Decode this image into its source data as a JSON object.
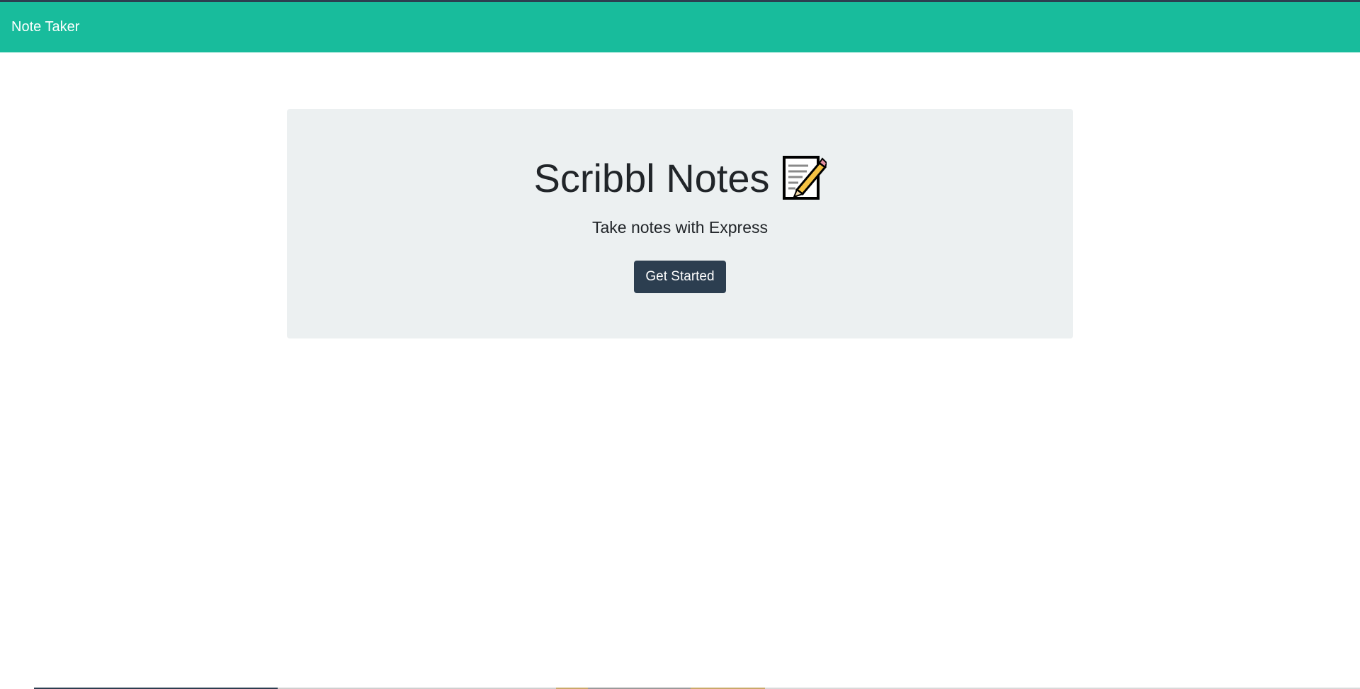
{
  "navbar": {
    "brand": "Note Taker"
  },
  "hero": {
    "title": "Scribbl Notes",
    "icon": "memo-icon",
    "subtitle": "Take notes with Express",
    "button_label": "Get Started"
  },
  "colors": {
    "navbar_bg": "#18bc9c",
    "top_rule": "#2c3e50",
    "jumbotron_bg": "#ecf0f1",
    "button_bg": "#2c3e50",
    "text_dark": "#212529"
  }
}
